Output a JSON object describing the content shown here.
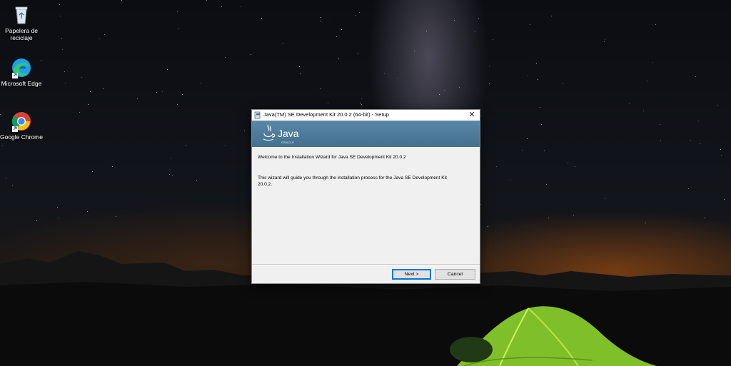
{
  "desktop": {
    "icons": [
      {
        "label_line1": "Papelera de",
        "label_line2": "reciclaje",
        "icon": "recycle-bin-icon"
      },
      {
        "label_line1": "Microsoft Edge",
        "label_line2": "",
        "icon": "edge-icon"
      },
      {
        "label_line1": "Google Chrome",
        "label_line2": "",
        "icon": "chrome-icon"
      }
    ]
  },
  "window": {
    "title": "Java(TM) SE Development Kit 20.0.2 (64-bit) - Setup",
    "close_glyph": "✕",
    "banner": {
      "logo_text": "Java",
      "vendor_text": "ORACLE"
    },
    "welcome": "Welcome to the Installation Wizard for Java SE Development Kit 20.0.2",
    "description": "This wizard will guide you through the installation process for the Java SE Development Kit 20.0.2.",
    "buttons": {
      "next": "Next >",
      "cancel": "Cancel"
    }
  },
  "colors": {
    "banner": "#4f7c9c",
    "default_button_border": "#0078d7"
  }
}
